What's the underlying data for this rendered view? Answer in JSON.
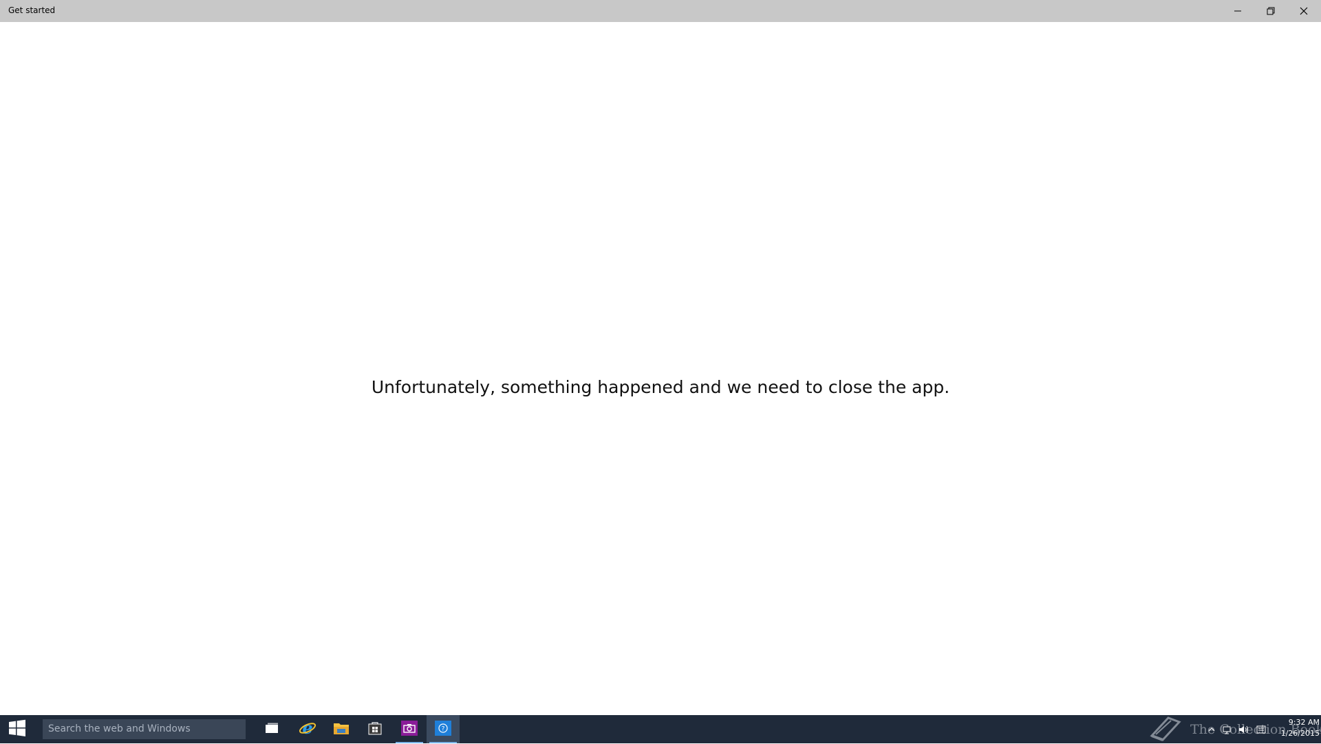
{
  "window": {
    "title": "Get started",
    "controls": {
      "minimize": "minimize-icon",
      "maximize": "restore-icon",
      "close": "close-icon"
    }
  },
  "main": {
    "message": "Unfortunately, something happened and we need to close the app."
  },
  "taskbar": {
    "search_placeholder": "Search the web and Windows",
    "apps": [
      {
        "icon": "task-view-icon"
      },
      {
        "icon": "internet-explorer-icon"
      },
      {
        "icon": "file-explorer-icon"
      },
      {
        "icon": "store-icon"
      },
      {
        "icon": "camera-icon",
        "running": true
      },
      {
        "icon": "get-started-icon",
        "active": true
      }
    ],
    "watermark": "The Collection Book",
    "tray_icons": [
      "chevron-up-icon",
      "network-icon",
      "volume-icon",
      "action-center-icon"
    ],
    "clock": {
      "time": "9:32 AM",
      "date": "1/26/2015"
    }
  },
  "colors": {
    "titlebar": "#c8c8c8",
    "taskbar": "#1f2a3a",
    "search_box": "#3a4657",
    "accent": "#7ab3e8"
  }
}
